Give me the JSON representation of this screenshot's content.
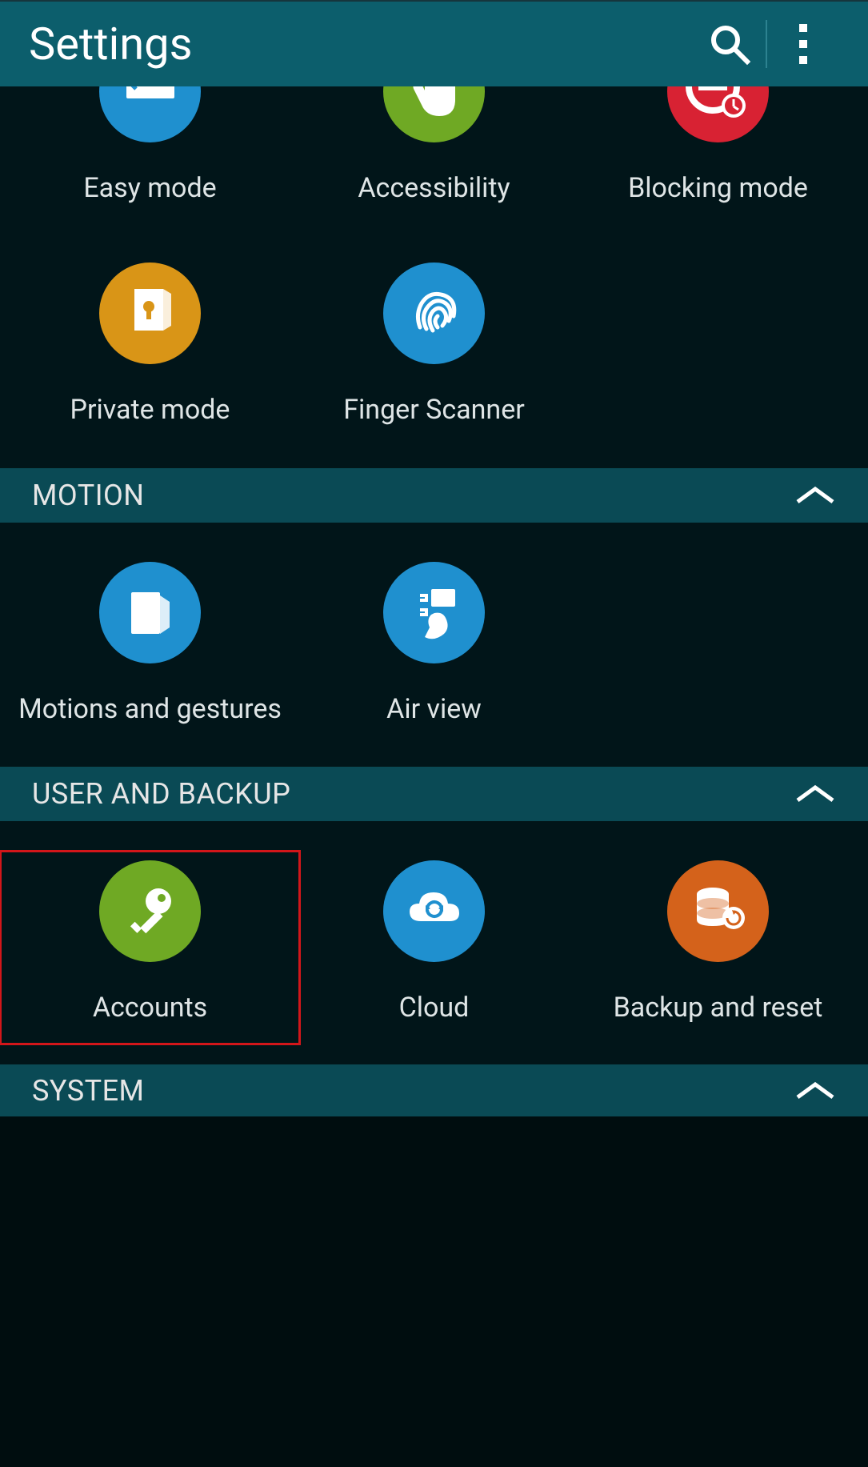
{
  "header": {
    "title": "Settings"
  },
  "personalization": {
    "items": [
      {
        "id": "easy-mode",
        "label": "Easy mode",
        "color": "blue",
        "icon": "easy"
      },
      {
        "id": "accessibility",
        "label": "Accessibility",
        "color": "green",
        "icon": "hand"
      },
      {
        "id": "blocking-mode",
        "label": "Blocking mode",
        "color": "red",
        "icon": "blocking"
      },
      {
        "id": "private-mode",
        "label": "Private mode",
        "color": "amber",
        "icon": "private"
      },
      {
        "id": "finger-scanner",
        "label": "Finger Scanner",
        "color": "blue",
        "icon": "fingerprint"
      }
    ]
  },
  "sections": [
    {
      "id": "motion",
      "label": "MOTION",
      "items": [
        {
          "id": "motions-gestures",
          "label": "Motions and gestures",
          "color": "blue",
          "icon": "motion"
        },
        {
          "id": "air-view",
          "label": "Air view",
          "color": "blue",
          "icon": "airview"
        }
      ]
    },
    {
      "id": "user-backup",
      "label": "USER AND BACKUP",
      "items": [
        {
          "id": "accounts",
          "label": "Accounts",
          "color": "green",
          "icon": "key",
          "highlighted": true
        },
        {
          "id": "cloud",
          "label": "Cloud",
          "color": "blue",
          "icon": "cloud"
        },
        {
          "id": "backup-reset",
          "label": "Backup and reset",
          "color": "orange",
          "icon": "backup"
        }
      ]
    },
    {
      "id": "system",
      "label": "SYSTEM",
      "items": []
    }
  ],
  "colors": {
    "blue": "#1f90cf",
    "green": "#6fa924",
    "red": "#d82233",
    "amber": "#d99517",
    "orange": "#d4621b",
    "headerBg": "#0c5e6c",
    "sectionBg": "#0a4a55",
    "bodyBg": "#011519"
  }
}
